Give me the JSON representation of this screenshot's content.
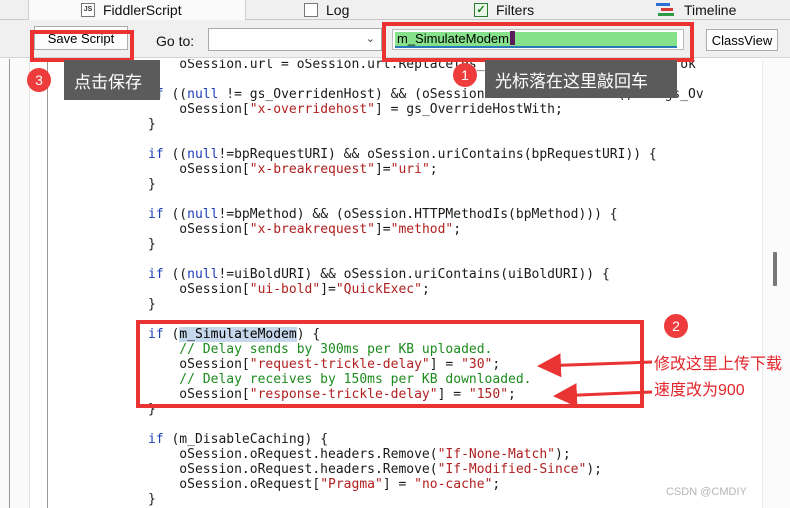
{
  "tabs": {
    "fiddlerscript": {
      "label": "FiddlerScript",
      "icon": "script-file-icon"
    },
    "log": {
      "label": "Log",
      "icon": "log-file-icon"
    },
    "filters": {
      "label": "Filters",
      "icon": "checkbox-icon"
    },
    "timeline": {
      "label": "Timeline",
      "icon": "timeline-icon"
    }
  },
  "toolbar": {
    "save_label": "Save Script",
    "goto_label": "Go to:",
    "goto_value": "",
    "search_value": "m_SimulateModem",
    "classview_label": "ClassView"
  },
  "code_lines": [
    [
      {
        "c": "tx",
        "t": "    oSession.url = oSession.url.Replace(gs_ReplaceToken, gs_ReplaceTok"
      }
    ],
    [
      {
        "c": "tx",
        "t": ""
      }
    ],
    [
      {
        "c": "kw",
        "t": "if"
      },
      {
        "c": "tx",
        "t": " (("
      },
      {
        "c": "kw",
        "t": "null"
      },
      {
        "c": "tx",
        "t": " != gs_OverridenHost) && (oSession.host.toLowerCase() == gs_Ov"
      }
    ],
    [
      {
        "c": "tx",
        "t": "    oSession["
      },
      {
        "c": "st",
        "t": "\"x-overridehost\""
      },
      {
        "c": "tx",
        "t": "] = gs_OverrideHostWith;"
      }
    ],
    [
      {
        "c": "tx",
        "t": "}"
      }
    ],
    [
      {
        "c": "tx",
        "t": ""
      }
    ],
    [
      {
        "c": "kw",
        "t": "if"
      },
      {
        "c": "tx",
        "t": " (("
      },
      {
        "c": "kw",
        "t": "null"
      },
      {
        "c": "tx",
        "t": "!=bpRequestURI) && oSession.uriContains(bpRequestURI)) {"
      }
    ],
    [
      {
        "c": "tx",
        "t": "    oSession["
      },
      {
        "c": "st",
        "t": "\"x-breakrequest\""
      },
      {
        "c": "tx",
        "t": "]="
      },
      {
        "c": "st",
        "t": "\"uri\""
      },
      {
        "c": "tx",
        "t": ";"
      }
    ],
    [
      {
        "c": "tx",
        "t": "}"
      }
    ],
    [
      {
        "c": "tx",
        "t": ""
      }
    ],
    [
      {
        "c": "kw",
        "t": "if"
      },
      {
        "c": "tx",
        "t": " (("
      },
      {
        "c": "kw",
        "t": "null"
      },
      {
        "c": "tx",
        "t": "!=bpMethod) && (oSession.HTTPMethodIs(bpMethod))) {"
      }
    ],
    [
      {
        "c": "tx",
        "t": "    oSession["
      },
      {
        "c": "st",
        "t": "\"x-breakrequest\""
      },
      {
        "c": "tx",
        "t": "]="
      },
      {
        "c": "st",
        "t": "\"method\""
      },
      {
        "c": "tx",
        "t": ";"
      }
    ],
    [
      {
        "c": "tx",
        "t": "}"
      }
    ],
    [
      {
        "c": "tx",
        "t": ""
      }
    ],
    [
      {
        "c": "kw",
        "t": "if"
      },
      {
        "c": "tx",
        "t": " (("
      },
      {
        "c": "kw",
        "t": "null"
      },
      {
        "c": "tx",
        "t": "!=uiBoldURI) && oSession.uriContains(uiBoldURI)) {"
      }
    ],
    [
      {
        "c": "tx",
        "t": "    oSession["
      },
      {
        "c": "st",
        "t": "\"ui-bold\""
      },
      {
        "c": "tx",
        "t": "]="
      },
      {
        "c": "st",
        "t": "\"QuickExec\""
      },
      {
        "c": "tx",
        "t": ";"
      }
    ],
    [
      {
        "c": "tx",
        "t": "}"
      }
    ],
    [
      {
        "c": "tx",
        "t": ""
      }
    ],
    [
      {
        "c": "kw",
        "t": "if"
      },
      {
        "c": "tx",
        "t": " ("
      },
      {
        "c": "sel",
        "t": "m_SimulateModem"
      },
      {
        "c": "tx",
        "t": ") {"
      }
    ],
    [
      {
        "c": "cm",
        "t": "    // Delay sends by 300ms per KB uploaded."
      }
    ],
    [
      {
        "c": "tx",
        "t": "    oSession["
      },
      {
        "c": "st",
        "t": "\"request-trickle-delay\""
      },
      {
        "c": "tx",
        "t": "] = "
      },
      {
        "c": "st",
        "t": "\"30\""
      },
      {
        "c": "tx",
        "t": ";"
      }
    ],
    [
      {
        "c": "cm",
        "t": "    // Delay receives by 150ms per KB downloaded."
      }
    ],
    [
      {
        "c": "tx",
        "t": "    oSession["
      },
      {
        "c": "st",
        "t": "\"response-trickle-delay\""
      },
      {
        "c": "tx",
        "t": "] = "
      },
      {
        "c": "st",
        "t": "\"150\""
      },
      {
        "c": "tx",
        "t": ";"
      }
    ],
    [
      {
        "c": "tx",
        "t": "}"
      }
    ],
    [
      {
        "c": "tx",
        "t": ""
      }
    ],
    [
      {
        "c": "kw",
        "t": "if"
      },
      {
        "c": "tx",
        "t": " (m_DisableCaching) {"
      }
    ],
    [
      {
        "c": "tx",
        "t": "    oSession.oRequest.headers.Remove("
      },
      {
        "c": "st",
        "t": "\"If-None-Match\""
      },
      {
        "c": "tx",
        "t": ");"
      }
    ],
    [
      {
        "c": "tx",
        "t": "    oSession.oRequest.headers.Remove("
      },
      {
        "c": "st",
        "t": "\"If-Modified-Since\""
      },
      {
        "c": "tx",
        "t": ");"
      }
    ],
    [
      {
        "c": "tx",
        "t": "    oSession.oRequest["
      },
      {
        "c": "st",
        "t": "\"Pragma\""
      },
      {
        "c": "tx",
        "t": "] = "
      },
      {
        "c": "st",
        "t": "\"no-cache\""
      },
      {
        "c": "tx",
        "t": ";"
      }
    ],
    [
      {
        "c": "tx",
        "t": "}"
      }
    ]
  ],
  "annotations": {
    "badge1": "1",
    "badge2": "2",
    "badge3": "3",
    "tip1": "光标落在这里敲回车",
    "tip3": "点击保存",
    "note2": "修改这里上传下载速度改为900"
  },
  "watermark": "CSDN @CMDIY",
  "colors": {
    "annotation_red": "#ea3333",
    "highlight_green": "#86e28a",
    "keyword_blue": "#1d3fb5",
    "string_red": "#b11f1f",
    "comment_green": "#1d8b1d"
  }
}
